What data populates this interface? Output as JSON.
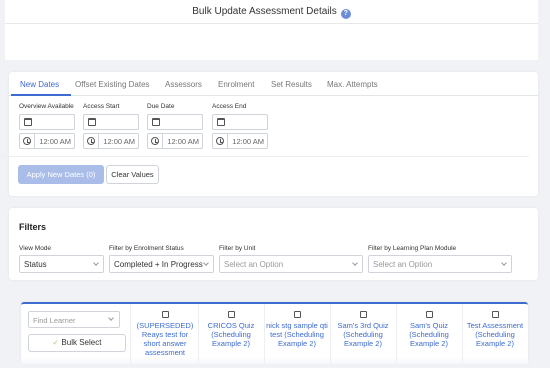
{
  "header": {
    "title": "Bulk Update Assessment Details",
    "help_icon": "help-icon",
    "help_glyph": "?"
  },
  "tabs": [
    {
      "label": "New Dates",
      "active": true
    },
    {
      "label": "Offset Existing Dates",
      "active": false
    },
    {
      "label": "Assessors",
      "active": false
    },
    {
      "label": "Enrolment",
      "active": false
    },
    {
      "label": "Set Results",
      "active": false
    },
    {
      "label": "Max. Attempts",
      "active": false
    }
  ],
  "date_fields": [
    {
      "label": "Overview Available",
      "date_value": "",
      "time_value": "12:00 AM"
    },
    {
      "label": "Access Start",
      "date_value": "",
      "time_value": "12:00 AM"
    },
    {
      "label": "Due Date",
      "date_value": "",
      "time_value": "12:00 AM"
    },
    {
      "label": "Access End",
      "date_value": "",
      "time_value": "12:00 AM"
    }
  ],
  "actions": {
    "apply_label": "Apply New Dates (0)",
    "clear_label": "Clear Values"
  },
  "filters": {
    "title": "Filters",
    "view_mode": {
      "label": "View Mode",
      "value": "Status"
    },
    "enrolment_status": {
      "label": "Filter by Enrolment Status",
      "value": "Completed + In Progress"
    },
    "unit": {
      "label": "Filter by Unit",
      "placeholder": "Select an Option"
    },
    "learning_plan_module": {
      "label": "Filter by Learning Plan Module",
      "placeholder": "Select an Option"
    }
  },
  "grid": {
    "find_learner_placeholder": "Find Learner",
    "bulk_select_label": "Bulk Select",
    "bulk_select_glyph": "✔",
    "columns": [
      {
        "title": "(SUPERSEDED) Reays test for short answer assessment"
      },
      {
        "title": "CRICOS Quiz (Scheduling Example 2)"
      },
      {
        "title": "nick stg sample qti test (Scheduling Example 2)"
      },
      {
        "title": "Sam's 3rd Quiz (Scheduling Example 2)"
      },
      {
        "title": "Sam's Quiz (Scheduling Example 2)"
      },
      {
        "title": "Test Assessment (Scheduling Example 2)"
      }
    ]
  },
  "colors": {
    "accent": "#3d6bcf",
    "apply_button_disabled": "#a9bde8",
    "background": "#f0f2f5"
  }
}
